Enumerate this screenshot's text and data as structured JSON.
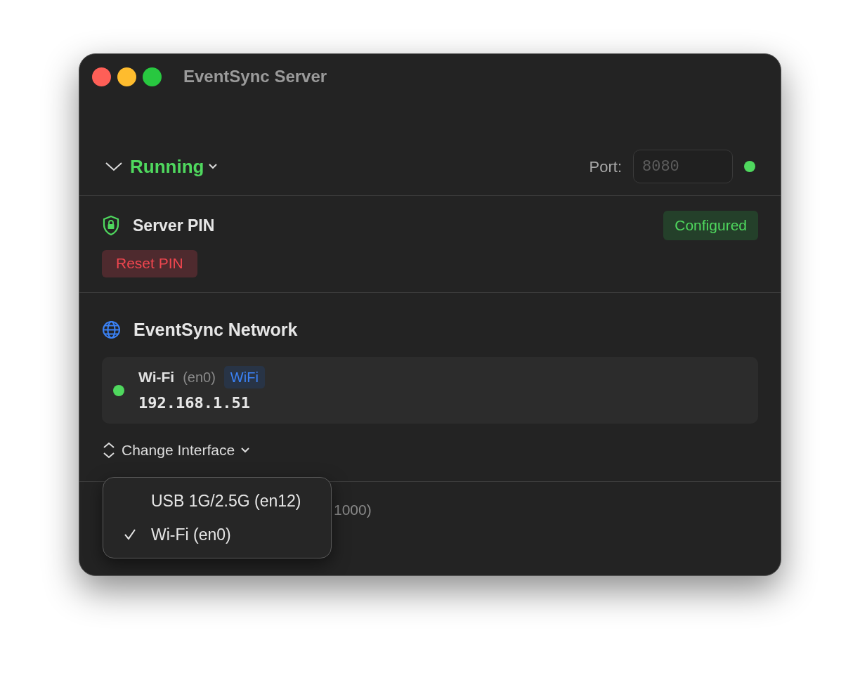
{
  "window": {
    "title": "EventSync Server"
  },
  "status": {
    "label": "Running",
    "expanded": true
  },
  "port": {
    "label": "Port:",
    "placeholder": "8080",
    "online": true
  },
  "server_pin": {
    "title": "Server PIN",
    "badge": "Configured",
    "reset_button": "Reset PIN"
  },
  "network": {
    "title": "EventSync Network",
    "interface": {
      "name": "Wi-Fi",
      "device": "(en0)",
      "tag": "WiFi",
      "ip": "192.168.1.51",
      "connected": true
    },
    "change_button": "Change Interface"
  },
  "debug_row": {
    "visible_text": "1000)"
  },
  "menu": {
    "items": [
      {
        "label": "USB 1G/2.5G (en12)",
        "selected": false
      },
      {
        "label": "Wi-Fi (en0)",
        "selected": true
      }
    ]
  }
}
